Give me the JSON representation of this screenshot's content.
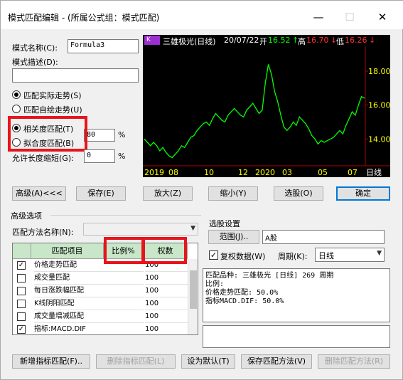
{
  "window": {
    "title": "模式匹配编辑 - (所属公式组：模式匹配)",
    "minimize_glyph": "—",
    "maximize_glyph": "☐",
    "close_glyph": "✕"
  },
  "form": {
    "name_label": "模式名称(C):",
    "name_value": "Formula3",
    "desc_label": "模式描述(D):",
    "desc_value": "",
    "radio_actual": "匹配实际走势(S)",
    "radio_custom": "匹配自绘走势(U)",
    "radio_correlation": "相关度匹配(T)",
    "correlation_value": "80",
    "radio_fit": "拟合度匹配(B)",
    "percent_sign": "%",
    "allow_shorten_label": "允许长度缩短(G):",
    "allow_shorten_value": "0",
    "percent_sign_2": "%"
  },
  "chart_header": {
    "badge": "K",
    "stock": "三雄极光(日线)",
    "date": "20/07/22",
    "open_label": "开",
    "open_value": "16.52",
    "open_arrow": "↑",
    "high_label": "高",
    "high_value": "16.70",
    "high_arrow": "↓",
    "low_label": "低",
    "low_value": "16.26",
    "low_arrow": "↓"
  },
  "chart_data": {
    "type": "line",
    "title": "",
    "price_ticks": [
      "18.00",
      "16.00",
      "14.00"
    ],
    "x_labels": [
      "2019",
      "08",
      "10",
      "12",
      "2020",
      "03",
      "05",
      "07"
    ],
    "period_label": "日线",
    "ylim": [
      12.5,
      19.3
    ],
    "series": [
      {
        "values": [
          14.0,
          13.8,
          13.6,
          13.8,
          13.6,
          13.3,
          13.5,
          13.2,
          13.0,
          12.9,
          13.1,
          13.3,
          13.6,
          13.5,
          13.8,
          14.1,
          14.2,
          14.5,
          14.7,
          14.9,
          15.0,
          14.8,
          15.2,
          15.5,
          15.3,
          15.1,
          15.0,
          15.4,
          15.6,
          15.8,
          15.6,
          15.4,
          15.3,
          15.7,
          15.9,
          16.1,
          15.8,
          15.5,
          15.7,
          17.3,
          18.4,
          17.8,
          16.8,
          16.2,
          15.4,
          14.7,
          14.5,
          14.7,
          15.0,
          14.8,
          15.3,
          15.1,
          14.9,
          14.6,
          14.2,
          14.0,
          13.7,
          13.9,
          13.8,
          13.9,
          14.0,
          14.1,
          14.3,
          14.5,
          14.3,
          14.8,
          15.2,
          15.6,
          15.4,
          16.0,
          16.5,
          16.4
        ]
      }
    ]
  },
  "buttons": {
    "advanced": "高级(A)<<<",
    "save": "保存(E)",
    "zoom_in": "放大(Z)",
    "zoom_out": "缩小(Y)",
    "select_stocks": "选股(O)",
    "ok": "确定",
    "add_indicator": "新增指标匹配(F)..",
    "delete_indicator": "删除指标匹配(L)",
    "set_default": "设为默认(T)",
    "save_method": "保存匹配方法(V)",
    "delete_method": "删除匹配方法(R)"
  },
  "advanced": {
    "section_label": "高级选项",
    "method_name_label": "匹配方法名称(N):",
    "method_name_value": ""
  },
  "match_table": {
    "headers": [
      "匹配项目",
      "比例%",
      "权数"
    ],
    "rows": [
      {
        "checked": true,
        "name": "价格走势匹配",
        "ratio": "",
        "weight": "100"
      },
      {
        "checked": false,
        "name": "成交量匹配",
        "ratio": "",
        "weight": "100"
      },
      {
        "checked": false,
        "name": "每日涨跌幅匹配",
        "ratio": "",
        "weight": "100"
      },
      {
        "checked": false,
        "name": "K线阴阳匹配",
        "ratio": "",
        "weight": "100"
      },
      {
        "checked": false,
        "name": "成交量增减匹配",
        "ratio": "",
        "weight": "100"
      },
      {
        "checked": true,
        "name": "指标:MACD.DIF",
        "ratio": "",
        "weight": "100"
      }
    ],
    "check_glyph": "✓"
  },
  "stock_select": {
    "section_label": "选股设置",
    "range_button": "范围(J)..",
    "range_value": "A股",
    "restore_label": "复权数据(W)",
    "restore_checked": true,
    "period_label": "周期(K):",
    "period_value": "日线",
    "summary": "匹配品种: 三雄极光 [日线] 269 周期\n比例:\n价格走势匹配: 50.0%\n指标MACD.DIF: 50.0%",
    "notes": ""
  },
  "colors": {
    "highlight_red": "#e8141c",
    "chart_bg": "#000000",
    "chart_line": "#00ff00",
    "price_axis": "#ffff00",
    "header_bg": "#c8e6c8",
    "accent": "#0078d7",
    "open_value_color": "#00ff00",
    "high_value_color": "#ff3030",
    "low_value_color": "#ff3030"
  }
}
